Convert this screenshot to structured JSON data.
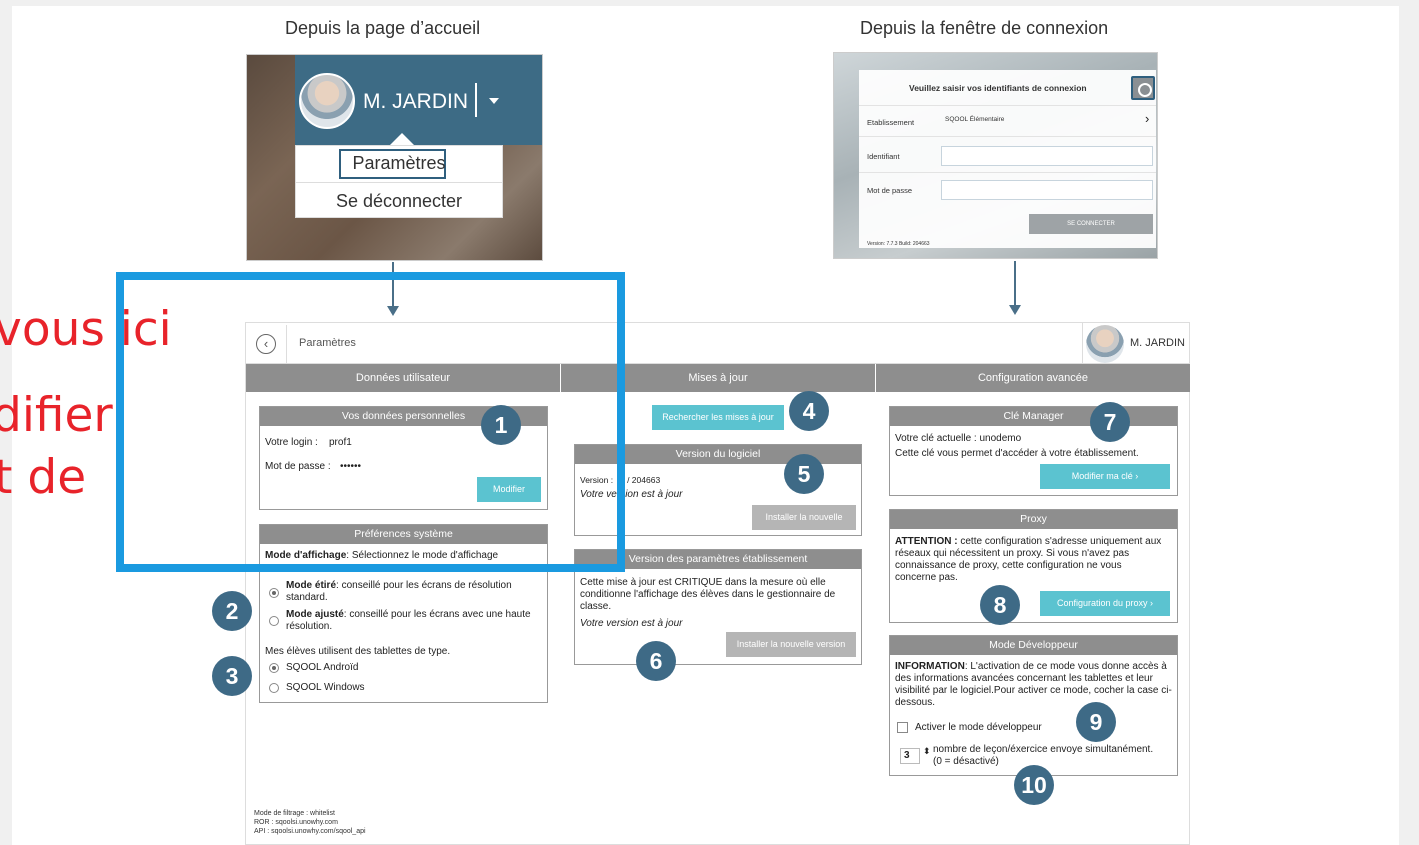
{
  "captions": {
    "left": "Depuis la page d’accueil",
    "right": "Depuis la fenêtre de connexion"
  },
  "home_panel": {
    "user_name": "M. JARDIN",
    "menu": [
      "Paramètres",
      "Se déconnecter"
    ]
  },
  "login_panel": {
    "title": "Veuillez saisir vos identifiants de connexion",
    "fields": [
      {
        "label": "Etablissement",
        "value": "SQOOL Élémentaire"
      },
      {
        "label": "Identifiant",
        "value": ""
      },
      {
        "label": "Mot de passe",
        "value": ""
      }
    ],
    "button": "SE CONNECTER",
    "version": "Version: 7.7.3 Build: 204663"
  },
  "settings": {
    "title": "Paramètres",
    "user_name": "M. JARDIN",
    "columns": [
      "Données utilisateur",
      "Mises à jour",
      "Configuration avancée"
    ],
    "personal": {
      "title": "Vos données personnelles",
      "login_label": "Votre login :",
      "login_value": "prof1",
      "password_label": "Mot de passe :",
      "password_value": "••••••",
      "button": "Modifier"
    },
    "prefs": {
      "title": "Préférences système",
      "display_label": "Mode d'affichage",
      "display_desc": ": Sélectionnez le mode d'affichage",
      "mode1_bold": "Mode étiré",
      "mode1_text": ": conseillé pour les écrans de résolution standard.",
      "mode2_bold": "Mode ajusté",
      "mode2_text": ": conseillé pour les écrans avec une haute résolution.",
      "tablet_question": "Mes élèves utilisent des tablettes de type.",
      "tablet_opt1": "SQOOL Androïd",
      "tablet_opt2": "SQOOL Windows"
    },
    "updates": {
      "check_button": "Rechercher les mises à jour",
      "software_title": "Version du logiciel",
      "software_version_label": "Version :",
      "software_version": "0 / 204663",
      "software_status": "Votre version est à jour",
      "software_button": "Installer la nouvelle version",
      "params_title": "Version des paramètres établissement",
      "params_text": "Cette mise à jour est CRITIQUE dans la mesure où elle conditionne l'affichage des élèves dans le gestionnaire de classe.",
      "params_status": "Votre version est à jour",
      "params_button": "Installer la nouvelle version"
    },
    "advanced": {
      "key_title": "Clé Manager",
      "key_current": "Votre clé actuelle : unodemo",
      "key_desc": "Cette clé vous permet d'accéder à votre établissement.",
      "key_button": "Modifier ma clé ›",
      "proxy_title": "Proxy",
      "proxy_bold": "ATTENTION :",
      "proxy_text": "cette configuration s'adresse uniquement aux réseaux qui nécessitent un proxy. Si vous n'avez pas connaissance de proxy, cette configuration ne vous concerne pas.",
      "proxy_button": "Configuration du proxy ›",
      "dev_title": "Mode Développeur",
      "dev_bold": "INFORMATION",
      "dev_text": ": L'activation de ce mode vous donne accès à des informations avancées concernant les tablettes et leur visibilité par le logiciel.Pour activer ce mode, cocher la case ci-dessous.",
      "dev_checkbox": "Activer le mode développeur",
      "dev_count": "3",
      "dev_count_text": "nombre de leçon/éxercice envoye simultanément.",
      "dev_count_note": "(0 = désactivé)"
    },
    "footer": [
      "Mode de filtrage : whitelist",
      "ROR : sqoolsi.unowhy.com",
      "API : sqoolsi.unowhy.com/sqool_api"
    ]
  },
  "badges": [
    "1",
    "2",
    "3",
    "4",
    "5",
    "6",
    "7",
    "8",
    "9",
    "10"
  ],
  "overlay_text": [
    "vous ici",
    "difier",
    "t de"
  ],
  "colors": {
    "accent_badge": "#3e6a86",
    "button_cyan": "#5bc3d0",
    "highlight_frame": "#1a9ae0",
    "overlay_text": "#e8232a"
  }
}
